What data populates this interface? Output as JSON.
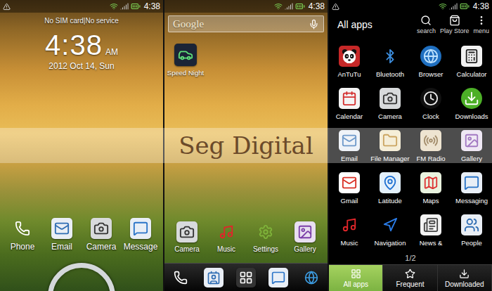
{
  "lock_screen": {
    "status_bar": {
      "time": "4:38"
    },
    "carrier": "No SIM card|No service",
    "clock": {
      "time": "4:38",
      "period": "AM"
    },
    "date": "2012 Oct 14, Sun",
    "shortcuts": [
      {
        "label": "Phone"
      },
      {
        "label": "Email"
      },
      {
        "label": "Camera"
      },
      {
        "label": "Message"
      }
    ]
  },
  "home_screen": {
    "status_bar": {
      "time": "4:38"
    },
    "search": {
      "placeholder": "Google"
    },
    "desktop_apps": [
      {
        "label": "Speed Night"
      }
    ],
    "dock": [
      {
        "label": "Camera"
      },
      {
        "label": "Music"
      },
      {
        "label": "Settings"
      },
      {
        "label": "Gallery"
      }
    ]
  },
  "all_apps": {
    "status_bar": {
      "time": "4:38"
    },
    "title": "All apps",
    "actions": [
      {
        "label": "search"
      },
      {
        "label": "Play Store"
      },
      {
        "label": "menu"
      }
    ],
    "apps": [
      {
        "label": "AnTuTu"
      },
      {
        "label": "Bluetooth"
      },
      {
        "label": "Browser"
      },
      {
        "label": "Calculator"
      },
      {
        "label": "Calendar"
      },
      {
        "label": "Camera"
      },
      {
        "label": "Clock"
      },
      {
        "label": "Downloads"
      },
      {
        "label": "Email"
      },
      {
        "label": "File Manager"
      },
      {
        "label": "FM Radio"
      },
      {
        "label": "Gallery"
      },
      {
        "label": "Gmail"
      },
      {
        "label": "Latitude"
      },
      {
        "label": "Maps"
      },
      {
        "label": "Messaging"
      },
      {
        "label": "Music"
      },
      {
        "label": "Navigation"
      },
      {
        "label": "News &"
      },
      {
        "label": "People"
      }
    ],
    "page": "1/2",
    "tabs": [
      {
        "label": "All apps",
        "selected": true
      },
      {
        "label": "Frequent",
        "selected": false
      },
      {
        "label": "Downloaded",
        "selected": false
      }
    ]
  },
  "watermark": {
    "text": "Seg Digital"
  }
}
